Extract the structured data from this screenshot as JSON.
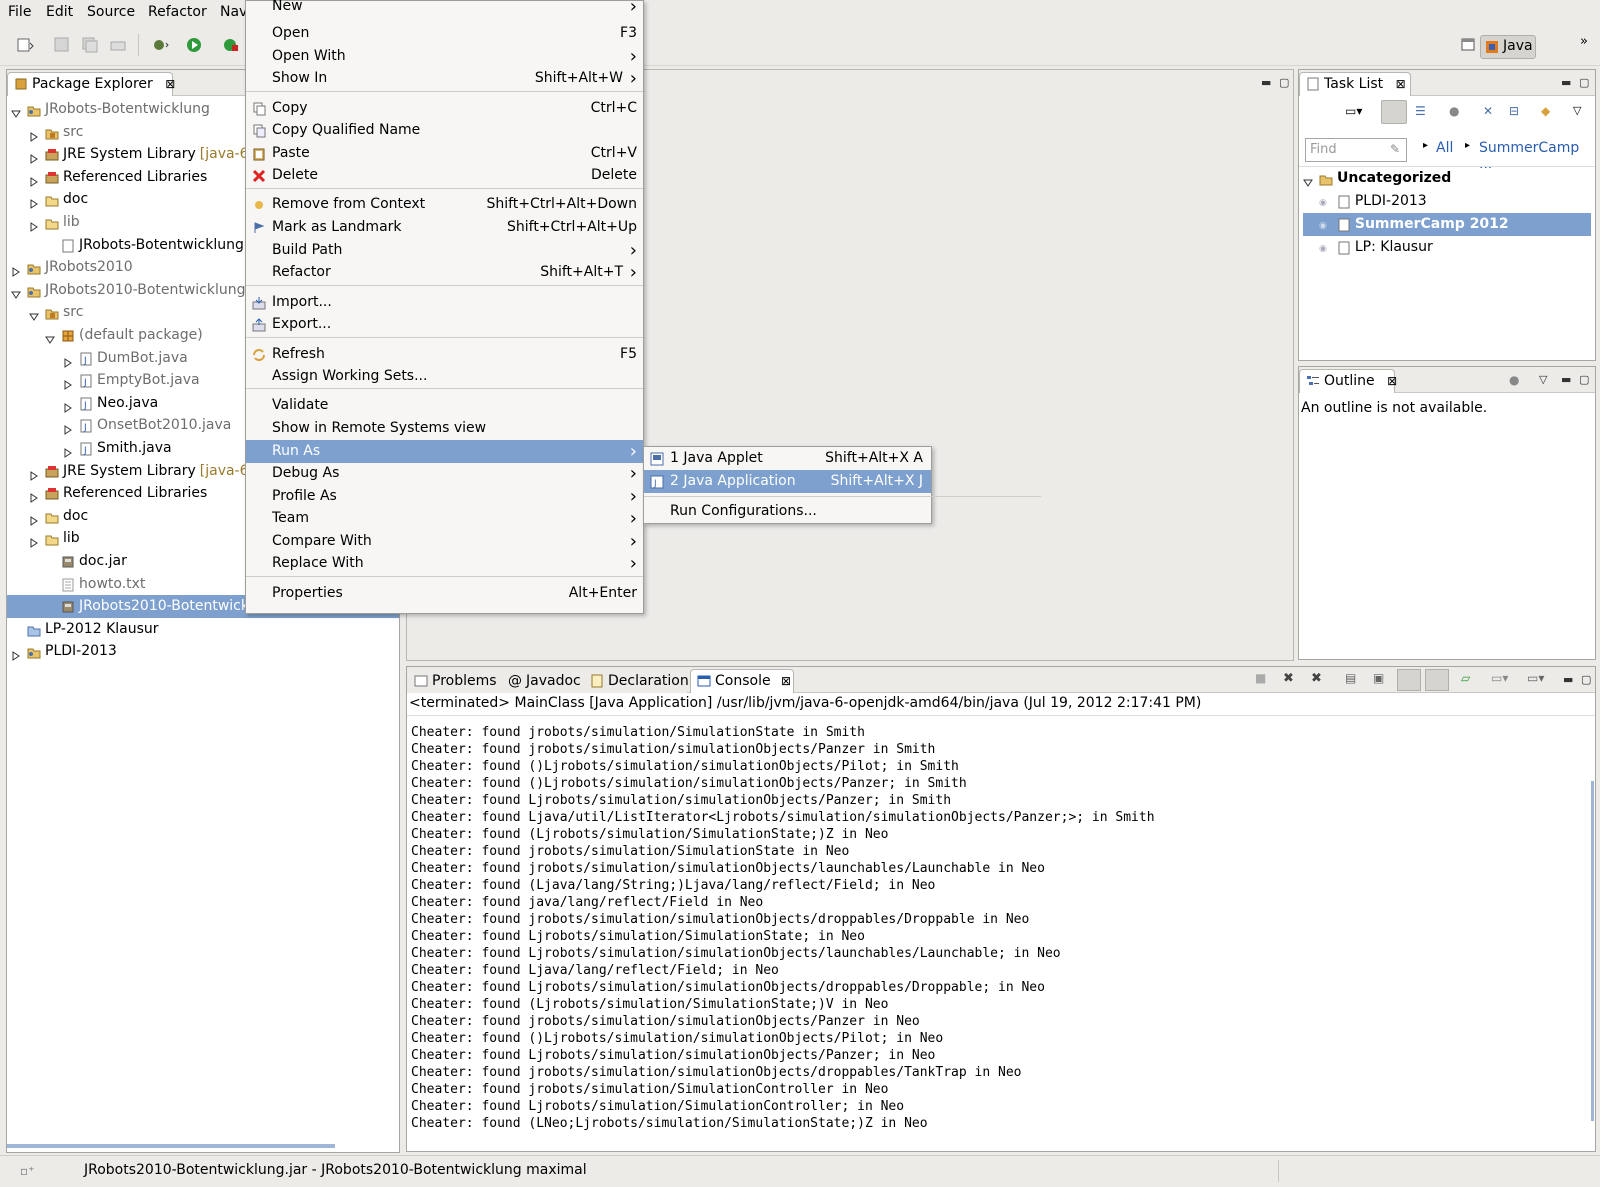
{
  "menubar": {
    "items": [
      "File",
      "Edit",
      "Source",
      "Refactor",
      "Nav"
    ]
  },
  "perspective": {
    "label": "Java"
  },
  "package_explorer": {
    "title": "Package Explorer",
    "rows": [
      {
        "label": "JRobots-Botentwicklung",
        "extra": ""
      },
      {
        "label": "src",
        "extra": ""
      },
      {
        "label": "JRE System Library",
        "extra": "[java-6-o"
      },
      {
        "label": "Referenced Libraries",
        "extra": ""
      },
      {
        "label": "doc",
        "extra": ""
      },
      {
        "label": "lib",
        "extra": ""
      },
      {
        "label": "JRobots-Botentwicklung.la",
        "extra": ""
      },
      {
        "label": "JRobots2010",
        "extra": ""
      },
      {
        "label": "JRobots2010-Botentwicklung",
        "extra": ""
      },
      {
        "label": "src",
        "extra": ""
      },
      {
        "label": "(default package)",
        "extra": ""
      },
      {
        "label": "DumBot.java",
        "extra": ""
      },
      {
        "label": "EmptyBot.java",
        "extra": ""
      },
      {
        "label": "Neo.java",
        "extra": ""
      },
      {
        "label": "OnsetBot2010.java",
        "extra": ""
      },
      {
        "label": "Smith.java",
        "extra": ""
      },
      {
        "label": "JRE System Library",
        "extra": "[java-6-o"
      },
      {
        "label": "Referenced Libraries",
        "extra": ""
      },
      {
        "label": "doc",
        "extra": ""
      },
      {
        "label": "lib",
        "extra": ""
      },
      {
        "label": "doc.jar",
        "extra": ""
      },
      {
        "label": "howto.txt",
        "extra": ""
      },
      {
        "label": "JRobots2010-Botentwicklung.jar",
        "extra": ""
      },
      {
        "label": "LP-2012 Klausur",
        "extra": ""
      },
      {
        "label": "PLDI-2013",
        "extra": ""
      }
    ]
  },
  "context_menu": {
    "items": [
      {
        "label": "New",
        "accel": ""
      },
      {
        "label": "Open",
        "accel": "F3"
      },
      {
        "label": "Open With",
        "accel": ""
      },
      {
        "label": "Show In",
        "accel": "Shift+Alt+W"
      },
      {
        "label": "Copy",
        "accel": "Ctrl+C"
      },
      {
        "label": "Copy Qualified Name",
        "accel": ""
      },
      {
        "label": "Paste",
        "accel": "Ctrl+V"
      },
      {
        "label": "Delete",
        "accel": "Delete"
      },
      {
        "label": "Remove from Context",
        "accel": "Shift+Ctrl+Alt+Down"
      },
      {
        "label": "Mark as Landmark",
        "accel": "Shift+Ctrl+Alt+Up"
      },
      {
        "label": "Build Path",
        "accel": ""
      },
      {
        "label": "Refactor",
        "accel": "Shift+Alt+T"
      },
      {
        "label": "Import...",
        "accel": ""
      },
      {
        "label": "Export...",
        "accel": ""
      },
      {
        "label": "Refresh",
        "accel": "F5"
      },
      {
        "label": "Assign Working Sets...",
        "accel": ""
      },
      {
        "label": "Validate",
        "accel": ""
      },
      {
        "label": "Show in Remote Systems view",
        "accel": ""
      },
      {
        "label": "Run As",
        "accel": ""
      },
      {
        "label": "Debug As",
        "accel": ""
      },
      {
        "label": "Profile As",
        "accel": ""
      },
      {
        "label": "Team",
        "accel": ""
      },
      {
        "label": "Compare With",
        "accel": ""
      },
      {
        "label": "Replace With",
        "accel": ""
      },
      {
        "label": "Properties",
        "accel": "Alt+Enter"
      }
    ]
  },
  "run_as_submenu": {
    "items": [
      {
        "label": "1 Java Applet",
        "accel": "Shift+Alt+X A"
      },
      {
        "label": "2 Java Application",
        "accel": "Shift+Alt+X J"
      },
      {
        "label": "Run Configurations...",
        "accel": ""
      }
    ]
  },
  "task_list": {
    "title": "Task List",
    "find_placeholder": "Find",
    "filter_all": "All",
    "filter_summer": "SummerCamp ...",
    "group": "Uncategorized",
    "tasks": [
      "PLDI-2013",
      "SummerCamp 2012",
      "LP: Klausur"
    ]
  },
  "outline": {
    "title": "Outline",
    "message": "An outline is not available."
  },
  "bottom_tabs": {
    "problems": "Problems",
    "javadoc": "Javadoc",
    "declaration": "Declaration",
    "console": "Console"
  },
  "console": {
    "header": "<terminated> MainClass [Java Application] /usr/lib/jvm/java-6-openjdk-amd64/bin/java (Jul 19, 2012 2:17:41 PM)",
    "lines": [
      "Cheater: found jrobots/simulation/SimulationState in Smith",
      "Cheater: found jrobots/simulation/simulationObjects/Panzer in Smith",
      "Cheater: found ()Ljrobots/simulation/simulationObjects/Pilot; in Smith",
      "Cheater: found ()Ljrobots/simulation/simulationObjects/Panzer; in Smith",
      "Cheater: found Ljrobots/simulation/simulationObjects/Panzer; in Smith",
      "Cheater: found Ljava/util/ListIterator<Ljrobots/simulation/simulationObjects/Panzer;>; in Smith",
      "Cheater: found (Ljrobots/simulation/SimulationState;)Z in Neo",
      "Cheater: found jrobots/simulation/SimulationState in Neo",
      "Cheater: found jrobots/simulation/simulationObjects/launchables/Launchable in Neo",
      "Cheater: found (Ljava/lang/String;)Ljava/lang/reflect/Field; in Neo",
      "Cheater: found java/lang/reflect/Field in Neo",
      "Cheater: found jrobots/simulation/simulationObjects/droppables/Droppable in Neo",
      "Cheater: found Ljrobots/simulation/SimulationState; in Neo",
      "Cheater: found Ljrobots/simulation/simulationObjects/launchables/Launchable; in Neo",
      "Cheater: found Ljava/lang/reflect/Field; in Neo",
      "Cheater: found Ljrobots/simulation/simulationObjects/droppables/Droppable; in Neo",
      "Cheater: found (Ljrobots/simulation/SimulationState;)V in Neo",
      "Cheater: found jrobots/simulation/simulationObjects/Panzer in Neo",
      "Cheater: found ()Ljrobots/simulation/simulationObjects/Pilot; in Neo",
      "Cheater: found Ljrobots/simulation/simulationObjects/Panzer; in Neo",
      "Cheater: found jrobots/simulation/simulationObjects/droppables/TankTrap in Neo",
      "Cheater: found jrobots/simulation/SimulationController in Neo",
      "Cheater: found Ljrobots/simulation/SimulationController; in Neo",
      "Cheater: found (LNeo;Ljrobots/simulation/SimulationState;)Z in Neo"
    ]
  },
  "status": {
    "text": "JRobots2010-Botentwicklung.jar - JRobots2010-Botentwicklung maximal"
  },
  "colors": {
    "selection": "#7da0cf",
    "panel_bg": "#ffffff",
    "chrome_bg": "#ecebe8"
  }
}
